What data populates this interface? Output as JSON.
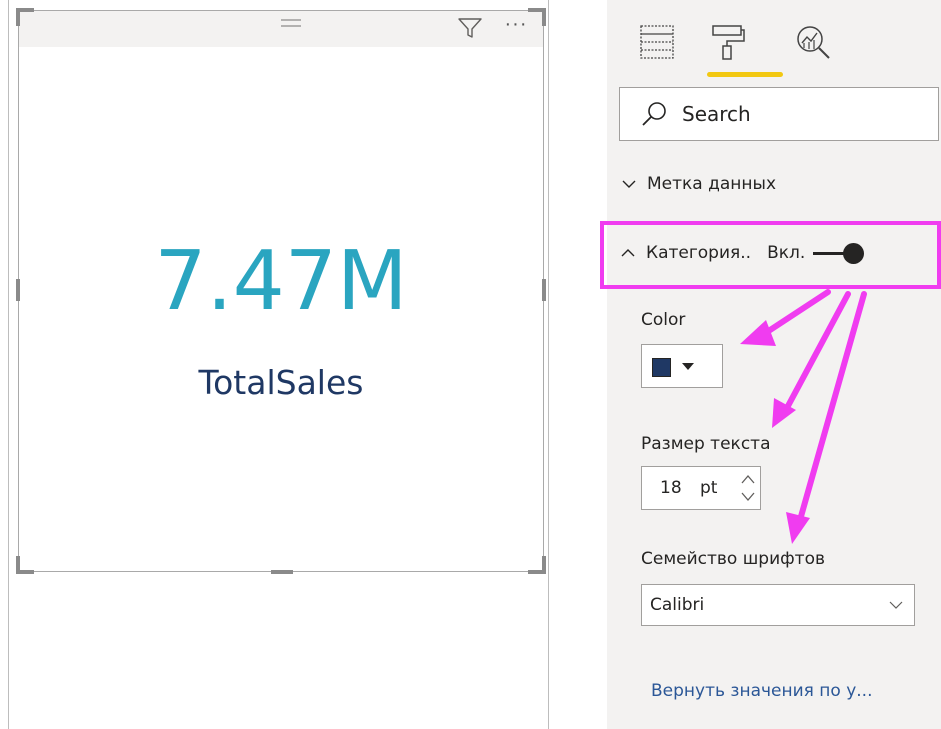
{
  "card": {
    "value": "7.47M",
    "label": "TotalSales",
    "value_color": "#2aa5c0",
    "label_color": "#1f3864"
  },
  "visual_header": {
    "filter_icon": "filter-icon",
    "more_icon": "more-options-icon",
    "more_label": "···"
  },
  "pane": {
    "tabs": [
      {
        "icon": "fields-icon"
      },
      {
        "icon": "paint-roller-icon",
        "active": true
      },
      {
        "icon": "analytics-icon"
      }
    ],
    "accent_color": "#f2c811",
    "search": {
      "placeholder": "Search"
    },
    "sections": {
      "data_label": "Метка данных",
      "category": {
        "label": "Категория..",
        "toggle_state": "Вкл.",
        "toggle_on": true
      }
    },
    "color": {
      "label": "Color",
      "value": "#1f3864"
    },
    "text_size": {
      "label": "Размер текста",
      "value": "18",
      "unit": "pt"
    },
    "font_family": {
      "label": "Семейство шрифтов",
      "value": "Calibri"
    },
    "revert_link": "Вернуть значения по у..."
  },
  "annotation": {
    "highlight_color": "#f03cf0"
  }
}
